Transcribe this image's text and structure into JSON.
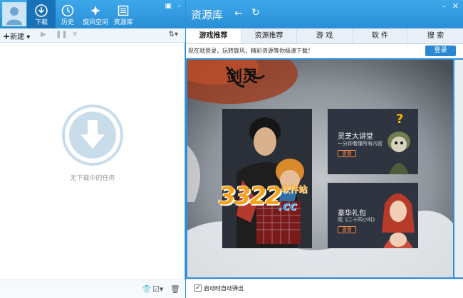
{
  "left_panel": {
    "nav": [
      {
        "label": "下载",
        "icon": "download-icon"
      },
      {
        "label": "历史",
        "icon": "clock-icon"
      },
      {
        "label": "旋风空间",
        "icon": "cloud-space-icon"
      },
      {
        "label": "资源库",
        "icon": "library-icon"
      }
    ],
    "toolbar": {
      "new_label": "新建"
    },
    "empty_text": "无下载中的任务"
  },
  "right_panel": {
    "title": "资源库",
    "tabs": [
      "游戏推荐",
      "资源推荐",
      "游 戏",
      "软 件",
      "搜 索"
    ],
    "login_tip": "现在就登录，玩转旋风，精彩资源等你极速下载！",
    "login_button": "登录",
    "banner": {
      "game_logo_text": "剑灵",
      "lecture": {
        "title": "灵芝大讲堂",
        "subtitle": "一分钟看懂所有内容",
        "button": "查看"
      },
      "gift": {
        "title": "豪华礼包",
        "subtitle": "观《二十四小时》",
        "button": "查看"
      },
      "watermark": {
        "number": "3322",
        "domain": ".cc",
        "site": "软件站"
      }
    },
    "footer": {
      "autostart_label": "启动时自动弹出",
      "checked": true
    }
  },
  "colors": {
    "header_blue": "#2a8fd6",
    "accent_orange": "#f08a4b"
  }
}
